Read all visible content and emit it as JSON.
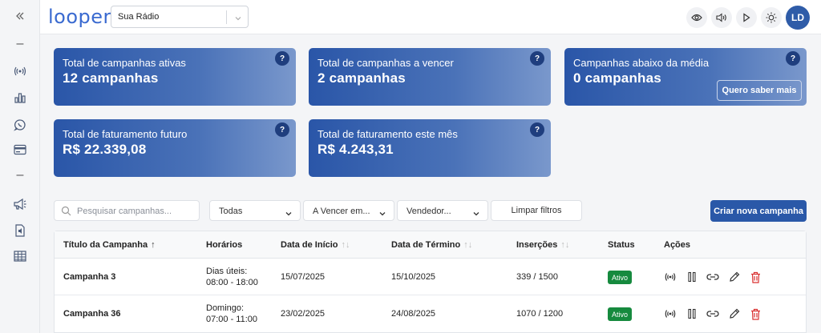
{
  "header": {
    "logo": "loopert",
    "radio_select": "Sua Rádio",
    "avatar": "LD"
  },
  "sidebar": {
    "items": [
      "collapse-icon",
      "dash",
      "broadcast-icon",
      "bar-chart-icon",
      "whatsapp-icon",
      "card-icon",
      "dash",
      "megaphone-icon",
      "audio-file-icon",
      "table-icon"
    ],
    "dash": "–"
  },
  "cards": [
    {
      "title": "Total de campanhas ativas",
      "value": "12 campanhas",
      "help": "?"
    },
    {
      "title": "Total de campanhas a vencer",
      "value": "2 campanhas",
      "help": "?"
    },
    {
      "title": "Campanhas abaixo da média",
      "value": "0 campanhas",
      "help": "?",
      "button": "Quero saber mais"
    },
    {
      "title": "Total de faturamento futuro",
      "value": "R$ 22.339,08",
      "help": "?"
    },
    {
      "title": "Total de faturamento este mês",
      "value": "R$ 4.243,31",
      "help": "?"
    }
  ],
  "filters": {
    "search_placeholder": "Pesquisar campanhas...",
    "status": "Todas",
    "expiring": "A Vencer em...",
    "seller": "Vendedor...",
    "clear": "Limpar filtros",
    "create": "Criar nova campanha"
  },
  "table": {
    "columns": [
      "Título da Campanha",
      "Horários",
      "Data de Início",
      "Data de Término",
      "Inserções",
      "Status",
      "Ações"
    ],
    "rows": [
      {
        "title": "Campanha 3",
        "schedule_day": "Dias úteis:",
        "schedule_time": "08:00 - 18:00",
        "start": "15/07/2025",
        "end": "15/10/2025",
        "insertions": "339 / 1500",
        "status": "Ativo"
      },
      {
        "title": "Campanha 36",
        "schedule_day": "Domingo:",
        "schedule_time": "07:00 - 11:00",
        "start": "23/02/2025",
        "end": "24/08/2025",
        "insertions": "1070 / 1200",
        "status": "Ativo"
      }
    ]
  },
  "colors": {
    "primary": "#2a58a8",
    "status_active": "#168a3e",
    "delete": "#d93030"
  }
}
